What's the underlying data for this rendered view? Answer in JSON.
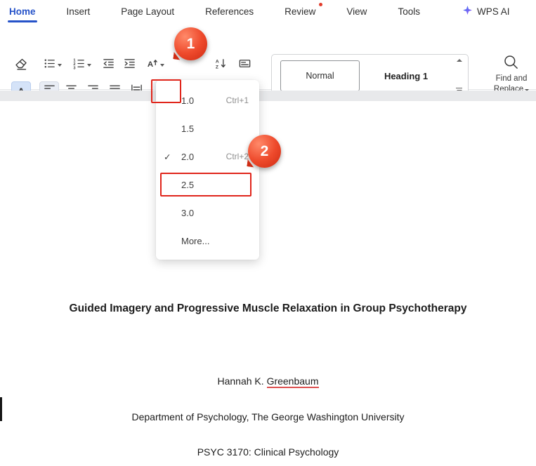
{
  "menubar": {
    "tabs": [
      {
        "label": "Home"
      },
      {
        "label": "Insert"
      },
      {
        "label": "Page Layout"
      },
      {
        "label": "References"
      },
      {
        "label": "Review"
      },
      {
        "label": "View"
      },
      {
        "label": "Tools"
      },
      {
        "label": "WPS AI"
      }
    ]
  },
  "ribbon": {
    "highlight_letter": "A",
    "style_gallery": {
      "styles": [
        {
          "label": "Normal"
        },
        {
          "label": "Heading 1"
        }
      ]
    },
    "find_replace": {
      "line1": "Find and",
      "line2": "Replace"
    }
  },
  "line_spacing_menu": {
    "items": [
      {
        "label": "1.0",
        "shortcut": "Ctrl+1"
      },
      {
        "label": "1.5",
        "shortcut": ""
      },
      {
        "label": "2.0",
        "shortcut": "Ctrl+2",
        "checked": true
      },
      {
        "label": "2.5",
        "shortcut": "",
        "boxed": true
      },
      {
        "label": "3.0",
        "shortcut": ""
      },
      {
        "label": "More...",
        "shortcut": ""
      }
    ],
    "checkmark": "✓"
  },
  "annotations": {
    "step1": "1",
    "step2": "2"
  },
  "document": {
    "title": "Guided Imagery and Progressive Muscle Relaxation in Group Psychotherapy",
    "author_prefix": "Hannah K. ",
    "author_surname": "Greenbaum",
    "affiliation": "Department of Psychology, The George Washington University",
    "course": "PSYC 3170: Clinical Psychology"
  },
  "colors": {
    "accent_blue": "#2653c9",
    "annotation_red": "#e0251b"
  }
}
